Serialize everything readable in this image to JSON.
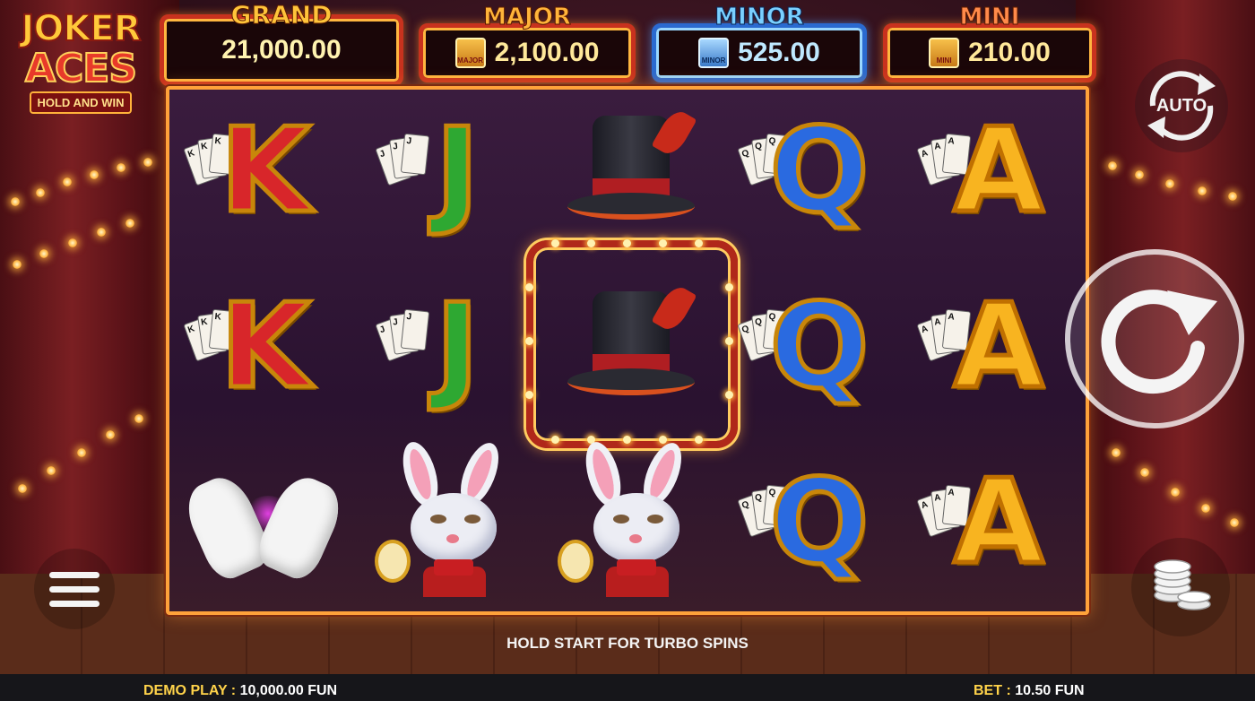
{
  "game": {
    "logo": {
      "line1": "JOKER",
      "line2": "ACES",
      "tagline": "HOLD AND WIN"
    }
  },
  "jackpots": {
    "grand": {
      "label": "GRAND",
      "value": "21,000.00"
    },
    "major": {
      "label": "MAJOR",
      "value": "2,100.00",
      "icon_text": "MAJOR"
    },
    "minor": {
      "label": "MINOR",
      "value": "525.00",
      "icon_text": "MINOR"
    },
    "mini": {
      "label": "MINI",
      "value": "210.00",
      "icon_text": "MINI"
    }
  },
  "reels": {
    "grid": [
      [
        "K",
        "J",
        "top-hat",
        "Q",
        "A"
      ],
      [
        "K",
        "J",
        "top-hat",
        "Q",
        "A"
      ],
      [
        "white-gloves",
        "rabbit",
        "rabbit",
        "Q",
        "A"
      ]
    ],
    "letters": {
      "K": "K",
      "J": "J",
      "Q": "Q",
      "A": "A"
    }
  },
  "controls": {
    "auto_label": "AUTO"
  },
  "hint": "HOLD START FOR TURBO SPINS",
  "footer": {
    "demo_label": "DEMO PLAY : ",
    "demo_value": "10,000.00 FUN",
    "bet_label": "BET : ",
    "bet_value": "10.50 FUN"
  },
  "colors": {
    "accent_gold": "#ffc43a",
    "minor_blue": "#2a6ad0",
    "frame_orange": "#ffa23a",
    "footer_bg": "#16161a"
  }
}
